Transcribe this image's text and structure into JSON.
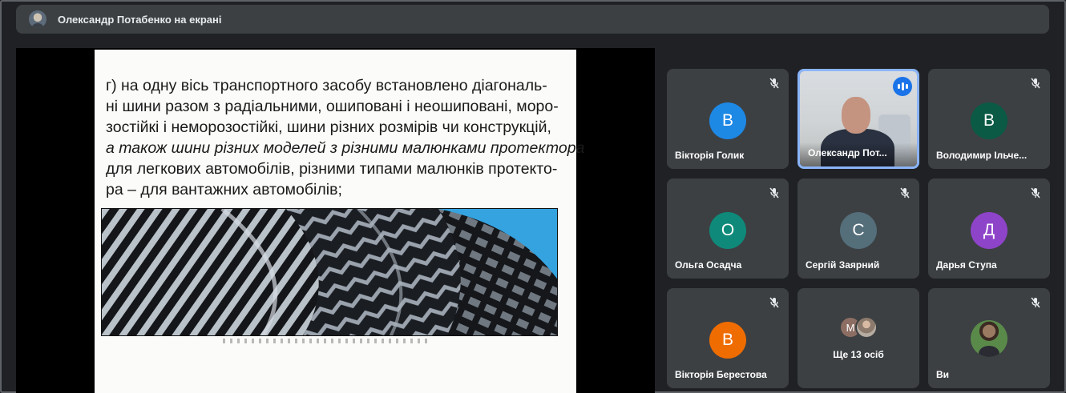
{
  "header": {
    "title": "Олександр Потабенко на екрані"
  },
  "presentation": {
    "lines": [
      "г) на одну вісь транспортного засобу встановлено діагональ-",
      "ні шини разом з радіальними, ошиповані і неошиповані, моро-",
      "зостійкі і неморозостійкі, шини різних розмірів чи конструкцій,",
      "а також шини різних моделей з різними малюнками протектора",
      "для легкових автомобілів, різними типами малюнків протекто-",
      "ра – для вантажних автомобілів;"
    ]
  },
  "participants": [
    {
      "name": "Вікторія Голик",
      "initial": "В",
      "color": "#1e88e5",
      "mic": "muted-icon"
    },
    {
      "name": "Олександр Пот...",
      "video": true,
      "speaking": true
    },
    {
      "name": "Володимир Ільче...",
      "initial": "В",
      "color": "#0b5a45",
      "mic": "muted-icon"
    },
    {
      "name": "Ольга Осадча",
      "initial": "О",
      "color": "#0f8a7a",
      "mic": "muted-icon"
    },
    {
      "name": "Сергій Заярний",
      "initial": "С",
      "color": "#546e7a",
      "mic": "muted-icon"
    },
    {
      "name": "Дарья Ступа",
      "initial": "Д",
      "color": "#8e44c9",
      "mic": "muted-icon"
    },
    {
      "name": "Вікторія Берестова",
      "initial": "В",
      "color": "#ef6c00",
      "mic": "muted-icon"
    },
    {
      "name": "Ще 13 осіб",
      "first_initial": "М"
    },
    {
      "name": "Ви",
      "mic": "muted-icon"
    }
  ],
  "colors": {
    "background": "#202124",
    "tile": "#3c4043",
    "accent": "#8ab4f8",
    "speaking": "#1a73e8"
  }
}
